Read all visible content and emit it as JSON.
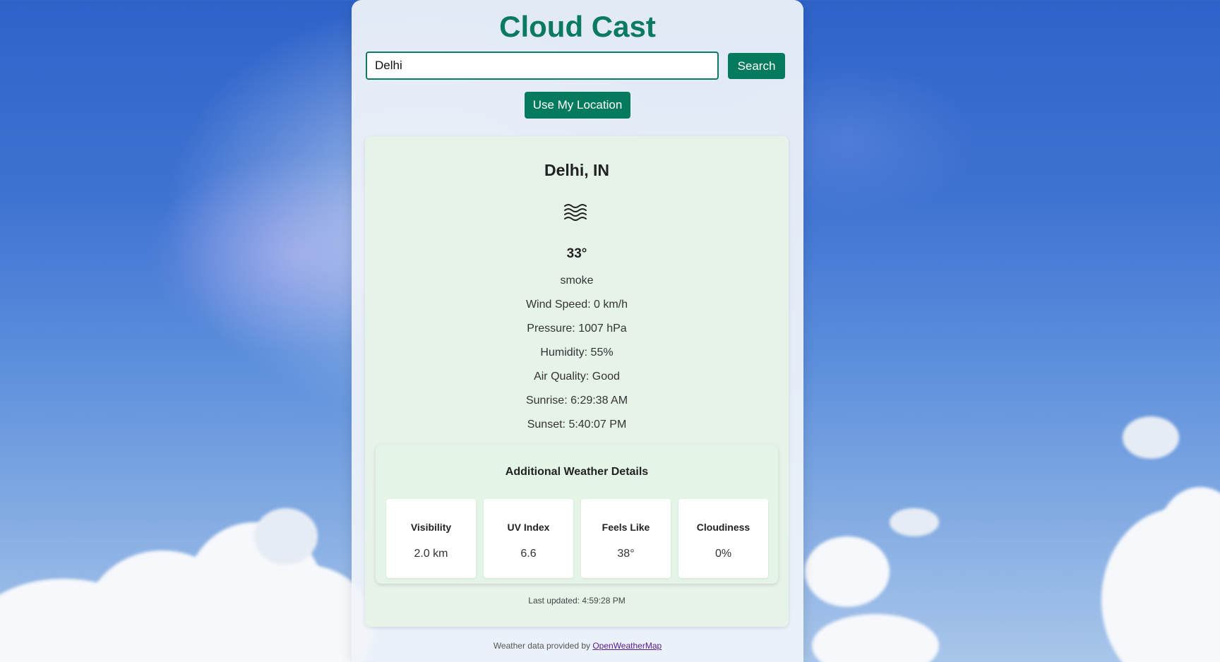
{
  "app": {
    "title": "Cloud Cast"
  },
  "search": {
    "value": "Delhi",
    "button_label": "Search"
  },
  "location_button_label": "Use My Location",
  "weather": {
    "city": "Delhi, IN",
    "icon": "fog-waves-icon",
    "temperature": "33°",
    "description": "smoke",
    "wind_speed": "Wind Speed: 0 km/h",
    "pressure": "Pressure: 1007 hPa",
    "humidity": "Humidity: 55%",
    "air_quality": "Air Quality: Good",
    "sunrise": "Sunrise: 6:29:38 AM",
    "sunset": "Sunset: 5:40:07 PM"
  },
  "details": {
    "title": "Additional Weather Details",
    "tiles": [
      {
        "label": "Visibility",
        "value": "2.0 km"
      },
      {
        "label": "UV Index",
        "value": "6.6"
      },
      {
        "label": "Feels Like",
        "value": "38°"
      },
      {
        "label": "Cloudiness",
        "value": "0%"
      }
    ]
  },
  "last_updated": "Last updated: 4:59:28 PM",
  "footer": {
    "text": "Weather data provided by ",
    "link_label": "OpenWeatherMap"
  },
  "colors": {
    "accent": "#067a5c",
    "title": "#0a7a63",
    "card": "#e6f3e9"
  }
}
